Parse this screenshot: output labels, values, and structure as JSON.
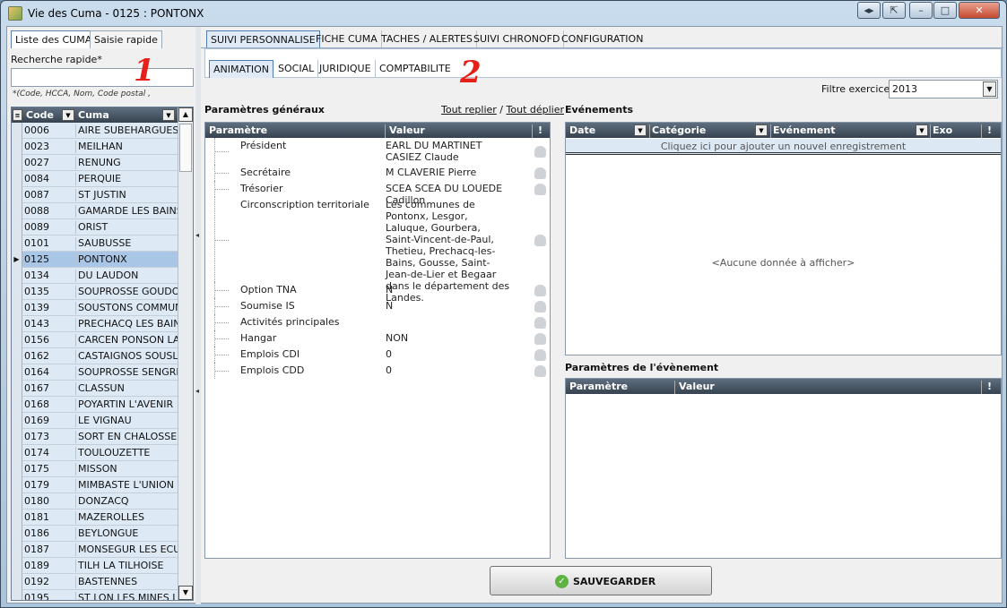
{
  "window": {
    "title": "Vie des Cuma - 0125 : PONTONX"
  },
  "left": {
    "tabs": [
      "Liste des CUMA",
      "Saisie rapide"
    ],
    "search_label": "Recherche rapide*",
    "search_value": "",
    "hint": "*(Code, HCCA, Nom, Code postal ,",
    "columns": [
      "Code",
      "Cuma"
    ],
    "rows": [
      {
        "code": "0006",
        "name": "AIRE SUBEHARGUES"
      },
      {
        "code": "0023",
        "name": "MEILHAN"
      },
      {
        "code": "0027",
        "name": "RENUNG"
      },
      {
        "code": "0084",
        "name": "PERQUIE"
      },
      {
        "code": "0087",
        "name": "ST JUSTIN"
      },
      {
        "code": "0088",
        "name": "GAMARDE LES BAINS"
      },
      {
        "code": "0089",
        "name": "ORIST"
      },
      {
        "code": "0101",
        "name": "SAUBUSSE"
      },
      {
        "code": "0125",
        "name": "PONTONX"
      },
      {
        "code": "0134",
        "name": "DU LAUDON"
      },
      {
        "code": "0135",
        "name": "SOUPROSSE GOUDOSS"
      },
      {
        "code": "0139",
        "name": "SOUSTONS COMMUNA"
      },
      {
        "code": "0143",
        "name": "PRECHACQ LES BAINS"
      },
      {
        "code": "0156",
        "name": "CARCEN PONSON LA M"
      },
      {
        "code": "0162",
        "name": "CASTAIGNOS SOUSLEN"
      },
      {
        "code": "0164",
        "name": "SOUPROSSE SENGRES"
      },
      {
        "code": "0167",
        "name": "CLASSUN"
      },
      {
        "code": "0168",
        "name": "POYARTIN L'AVENIR"
      },
      {
        "code": "0169",
        "name": "LE VIGNAU"
      },
      {
        "code": "0173",
        "name": "SORT EN CHALOSSE"
      },
      {
        "code": "0174",
        "name": "TOULOUZETTE"
      },
      {
        "code": "0175",
        "name": "MISSON"
      },
      {
        "code": "0179",
        "name": "MIMBASTE L'UNION"
      },
      {
        "code": "0180",
        "name": "DONZACQ"
      },
      {
        "code": "0181",
        "name": "MAZEROLLES"
      },
      {
        "code": "0186",
        "name": "BEYLONGUE"
      },
      {
        "code": "0187",
        "name": "MONSEGUR LES ECURE"
      },
      {
        "code": "0189",
        "name": "TILH LA TILHOISE"
      },
      {
        "code": "0192",
        "name": "BASTENNES"
      },
      {
        "code": "0195",
        "name": "ST LON LES MINES LA L"
      }
    ]
  },
  "main": {
    "tabs": [
      "SUIVI PERSONNALISE",
      "FICHE CUMA",
      "TACHES / ALERTES",
      "SUIVI CHRONOFD",
      "CONFIGURATION"
    ],
    "subtabs": [
      "ANIMATION",
      "SOCIAL",
      "JURIDIQUE",
      "COMPTABILITE"
    ],
    "filtre_label": "Filtre exercice",
    "filtre_value": "2013",
    "params_title": "Paramètres généraux",
    "link_collapse": "Tout replier",
    "link_sep": "/",
    "link_expand": "Tout déplier",
    "params_columns": [
      "Paramètre",
      "Valeur",
      "!"
    ],
    "params": [
      {
        "name": "Président",
        "value": "EARL DU MARTINET CASIEZ Claude"
      },
      {
        "name": "Secrétaire",
        "value": "M CLAVERIE Pierre"
      },
      {
        "name": "Trésorier",
        "value": "SCEA SCEA DU LOUEDE Cadillon"
      },
      {
        "name": "Circonscription territoriale",
        "value": "Les communes de Pontonx, Lesgor, Laluque, Gourbera, Saint-Vincent-de-Paul, Thetieu, Prechacq-les-Bains, Gousse, Saint-Jean-de-Lier et Begaar dans le département des Landes."
      },
      {
        "name": "Option TNA",
        "value": "N"
      },
      {
        "name": "Soumise IS",
        "value": "N"
      },
      {
        "name": "Activités principales",
        "value": ""
      },
      {
        "name": "Hangar",
        "value": "NON"
      },
      {
        "name": "Emplois CDI",
        "value": "0"
      },
      {
        "name": "Emplois CDD",
        "value": "0"
      }
    ],
    "events_title": "Evénements",
    "events_columns": [
      "Date",
      "Catégorie",
      "Evénement",
      "Exo",
      "!"
    ],
    "events_add": "Cliquez ici pour ajouter un nouvel enregistrement",
    "events_empty": "<Aucune donnée à afficher>",
    "event_params_title": "Paramètres de l'évènement",
    "event_params_columns": [
      "Paramètre",
      "Valeur",
      "!"
    ],
    "save_label": "SAUVEGARDER"
  },
  "annotations": [
    "1",
    "2"
  ]
}
